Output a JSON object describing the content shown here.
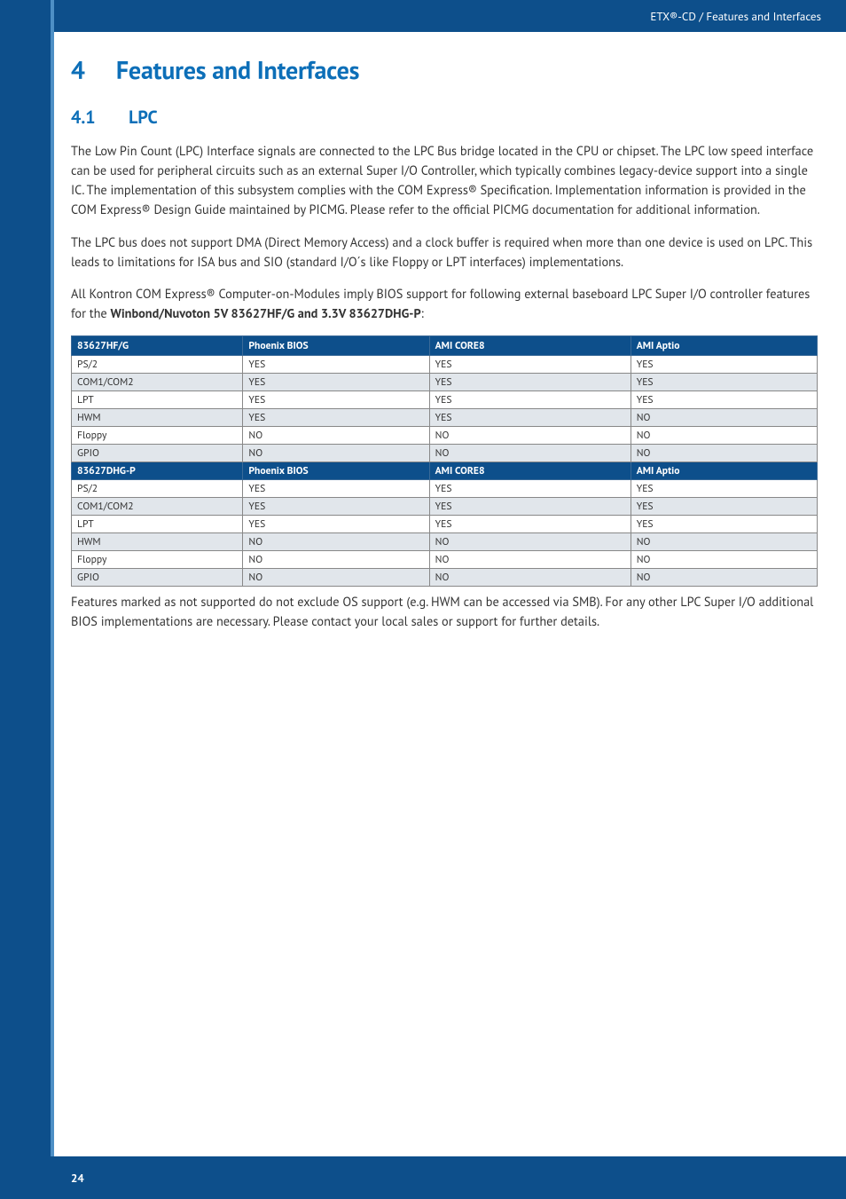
{
  "header": {
    "breadcrumb": "ETX®-CD / Features and Interfaces"
  },
  "h1": {
    "num": "4",
    "text": "Features and Interfaces"
  },
  "h2": {
    "num": "4.1",
    "text": "LPC"
  },
  "paras": {
    "p1": "The Low Pin Count (LPC) Interface signals are connected to the LPC Bus bridge located in the CPU or chipset. The LPC low speed interface can be used for peripheral circuits such as an external Super I/O Controller, which typically combines legacy-device support into a single IC. The implementation of this subsystem complies with the COM Express® Specification. Implementation information is provided in the COM Express® Design Guide maintained by PICMG. Please refer to the official PICMG documentation for additional information.",
    "p2": "The LPC bus does not support DMA (Direct Memory Access) and a clock buffer is required when more than one device is used on LPC. This leads to limitations for ISA bus and SIO (standard I/O´s like Floppy or LPT interfaces) implementations.",
    "p3a": "All Kontron COM Express® Computer-on-Modules imply BIOS support for following external baseboard LPC Super I/O controller features for the ",
    "p3b": "Winbond/Nuvoton 5V 83627HF/G and 3.3V 83627DHG-P",
    "p3c": ":",
    "p4": " Features marked as not supported do not exclude OS support (e.g. HWM can be accessed via SMB). For any other LPC Super I/O additional BIOS implementations are necessary. Please contact your local sales or support for further details."
  },
  "table": {
    "head": [
      "83627HF/G",
      "Phoenix BIOS",
      "AMI CORE8",
      "AMI Aptio"
    ],
    "rows1": [
      {
        "f": "PS/2",
        "c1": "YES",
        "c2": "YES",
        "c3": "YES"
      },
      {
        "f": "COM1/COM2",
        "c1": "YES",
        "c2": "YES",
        "c3": "YES"
      },
      {
        "f": "LPT",
        "c1": "YES",
        "c2": "YES",
        "c3": "YES"
      },
      {
        "f": "HWM",
        "c1": "YES",
        "c2": "YES",
        "c3": "NO"
      },
      {
        "f": "Floppy",
        "c1": "NO",
        "c2": "NO",
        "c3": "NO"
      },
      {
        "f": "GPIO",
        "c1": "NO",
        "c2": "NO",
        "c3": "NO"
      }
    ],
    "head2": [
      "83627DHG-P",
      "Phoenix BIOS",
      "AMI CORE8",
      "AMI Aptio"
    ],
    "rows2": [
      {
        "f": "PS/2",
        "c1": "YES",
        "c2": "YES",
        "c3": "YES"
      },
      {
        "f": "COM1/COM2",
        "c1": "YES",
        "c2": "YES",
        "c3": "YES"
      },
      {
        "f": "LPT",
        "c1": "YES",
        "c2": "YES",
        "c3": "YES"
      },
      {
        "f": "HWM",
        "c1": "NO",
        "c2": "NO",
        "c3": "NO"
      },
      {
        "f": "Floppy",
        "c1": "NO",
        "c2": "NO",
        "c3": "NO"
      },
      {
        "f": "GPIO",
        "c1": "NO",
        "c2": "NO",
        "c3": "NO"
      }
    ]
  },
  "footer": {
    "page": "24"
  }
}
